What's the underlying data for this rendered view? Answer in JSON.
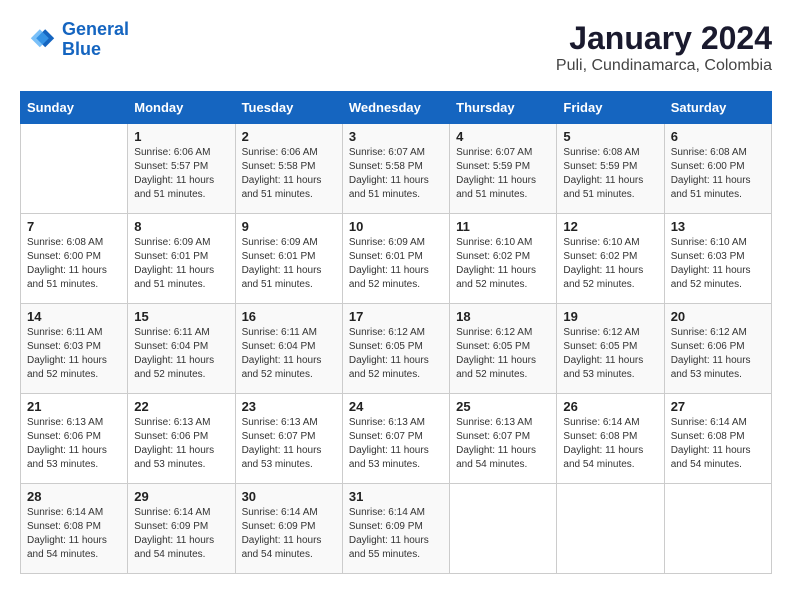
{
  "header": {
    "logo_line1": "General",
    "logo_line2": "Blue",
    "month_year": "January 2024",
    "location": "Puli, Cundinamarca, Colombia"
  },
  "days_of_week": [
    "Sunday",
    "Monday",
    "Tuesday",
    "Wednesday",
    "Thursday",
    "Friday",
    "Saturday"
  ],
  "weeks": [
    [
      {
        "day": "",
        "info": ""
      },
      {
        "day": "1",
        "info": "Sunrise: 6:06 AM\nSunset: 5:57 PM\nDaylight: 11 hours\nand 51 minutes."
      },
      {
        "day": "2",
        "info": "Sunrise: 6:06 AM\nSunset: 5:58 PM\nDaylight: 11 hours\nand 51 minutes."
      },
      {
        "day": "3",
        "info": "Sunrise: 6:07 AM\nSunset: 5:58 PM\nDaylight: 11 hours\nand 51 minutes."
      },
      {
        "day": "4",
        "info": "Sunrise: 6:07 AM\nSunset: 5:59 PM\nDaylight: 11 hours\nand 51 minutes."
      },
      {
        "day": "5",
        "info": "Sunrise: 6:08 AM\nSunset: 5:59 PM\nDaylight: 11 hours\nand 51 minutes."
      },
      {
        "day": "6",
        "info": "Sunrise: 6:08 AM\nSunset: 6:00 PM\nDaylight: 11 hours\nand 51 minutes."
      }
    ],
    [
      {
        "day": "7",
        "info": "Sunrise: 6:08 AM\nSunset: 6:00 PM\nDaylight: 11 hours\nand 51 minutes."
      },
      {
        "day": "8",
        "info": "Sunrise: 6:09 AM\nSunset: 6:01 PM\nDaylight: 11 hours\nand 51 minutes."
      },
      {
        "day": "9",
        "info": "Sunrise: 6:09 AM\nSunset: 6:01 PM\nDaylight: 11 hours\nand 51 minutes."
      },
      {
        "day": "10",
        "info": "Sunrise: 6:09 AM\nSunset: 6:01 PM\nDaylight: 11 hours\nand 52 minutes."
      },
      {
        "day": "11",
        "info": "Sunrise: 6:10 AM\nSunset: 6:02 PM\nDaylight: 11 hours\nand 52 minutes."
      },
      {
        "day": "12",
        "info": "Sunrise: 6:10 AM\nSunset: 6:02 PM\nDaylight: 11 hours\nand 52 minutes."
      },
      {
        "day": "13",
        "info": "Sunrise: 6:10 AM\nSunset: 6:03 PM\nDaylight: 11 hours\nand 52 minutes."
      }
    ],
    [
      {
        "day": "14",
        "info": "Sunrise: 6:11 AM\nSunset: 6:03 PM\nDaylight: 11 hours\nand 52 minutes."
      },
      {
        "day": "15",
        "info": "Sunrise: 6:11 AM\nSunset: 6:04 PM\nDaylight: 11 hours\nand 52 minutes."
      },
      {
        "day": "16",
        "info": "Sunrise: 6:11 AM\nSunset: 6:04 PM\nDaylight: 11 hours\nand 52 minutes."
      },
      {
        "day": "17",
        "info": "Sunrise: 6:12 AM\nSunset: 6:05 PM\nDaylight: 11 hours\nand 52 minutes."
      },
      {
        "day": "18",
        "info": "Sunrise: 6:12 AM\nSunset: 6:05 PM\nDaylight: 11 hours\nand 52 minutes."
      },
      {
        "day": "19",
        "info": "Sunrise: 6:12 AM\nSunset: 6:05 PM\nDaylight: 11 hours\nand 53 minutes."
      },
      {
        "day": "20",
        "info": "Sunrise: 6:12 AM\nSunset: 6:06 PM\nDaylight: 11 hours\nand 53 minutes."
      }
    ],
    [
      {
        "day": "21",
        "info": "Sunrise: 6:13 AM\nSunset: 6:06 PM\nDaylight: 11 hours\nand 53 minutes."
      },
      {
        "day": "22",
        "info": "Sunrise: 6:13 AM\nSunset: 6:06 PM\nDaylight: 11 hours\nand 53 minutes."
      },
      {
        "day": "23",
        "info": "Sunrise: 6:13 AM\nSunset: 6:07 PM\nDaylight: 11 hours\nand 53 minutes."
      },
      {
        "day": "24",
        "info": "Sunrise: 6:13 AM\nSunset: 6:07 PM\nDaylight: 11 hours\nand 53 minutes."
      },
      {
        "day": "25",
        "info": "Sunrise: 6:13 AM\nSunset: 6:07 PM\nDaylight: 11 hours\nand 54 minutes."
      },
      {
        "day": "26",
        "info": "Sunrise: 6:14 AM\nSunset: 6:08 PM\nDaylight: 11 hours\nand 54 minutes."
      },
      {
        "day": "27",
        "info": "Sunrise: 6:14 AM\nSunset: 6:08 PM\nDaylight: 11 hours\nand 54 minutes."
      }
    ],
    [
      {
        "day": "28",
        "info": "Sunrise: 6:14 AM\nSunset: 6:08 PM\nDaylight: 11 hours\nand 54 minutes."
      },
      {
        "day": "29",
        "info": "Sunrise: 6:14 AM\nSunset: 6:09 PM\nDaylight: 11 hours\nand 54 minutes."
      },
      {
        "day": "30",
        "info": "Sunrise: 6:14 AM\nSunset: 6:09 PM\nDaylight: 11 hours\nand 54 minutes."
      },
      {
        "day": "31",
        "info": "Sunrise: 6:14 AM\nSunset: 6:09 PM\nDaylight: 11 hours\nand 55 minutes."
      },
      {
        "day": "",
        "info": ""
      },
      {
        "day": "",
        "info": ""
      },
      {
        "day": "",
        "info": ""
      }
    ]
  ]
}
